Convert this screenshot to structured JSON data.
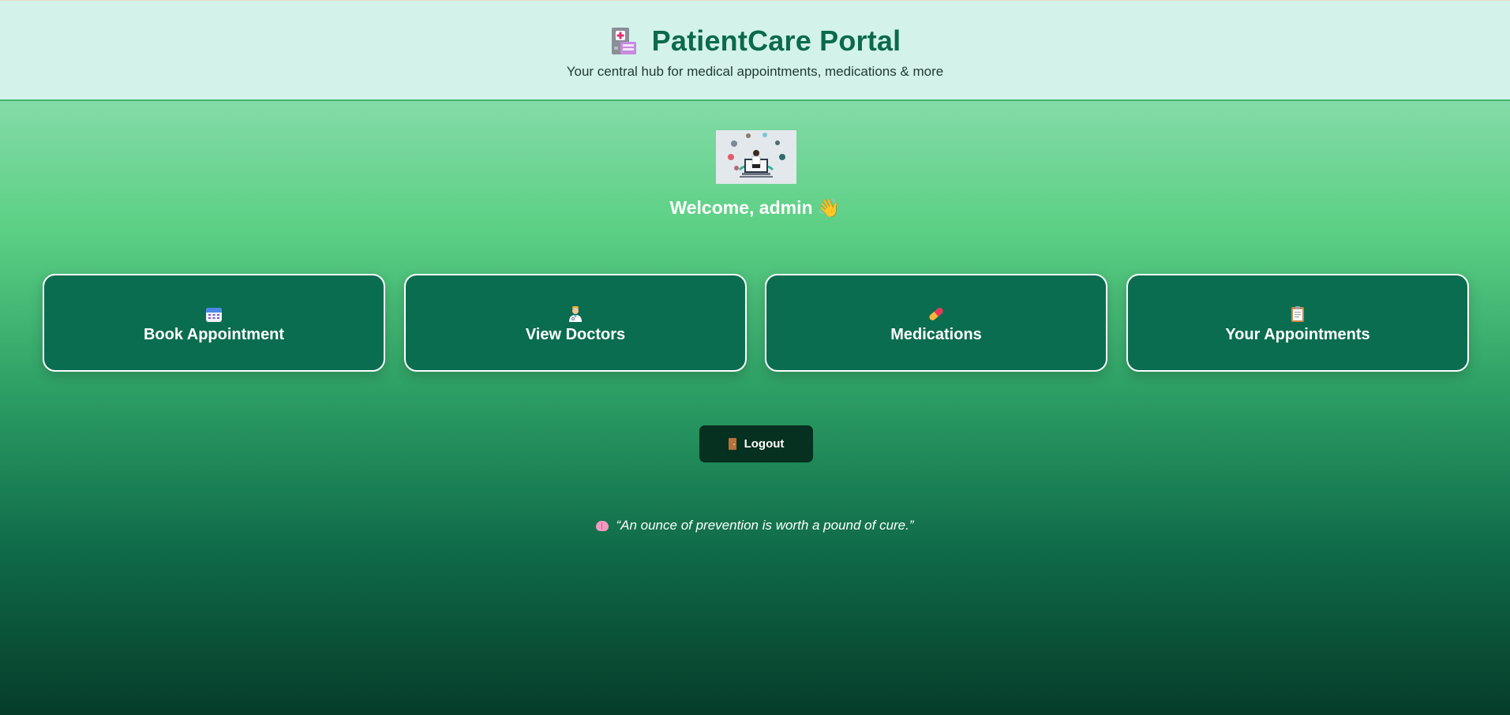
{
  "header": {
    "title": "PatientCare Portal",
    "subtitle": "Your central hub for medical appointments, medications & more",
    "title_icon": "hospital-icon"
  },
  "hero": {
    "image": "telemedicine-illustration"
  },
  "welcome": {
    "text": "Welcome, admin 👋"
  },
  "cards": [
    {
      "label": "Book Appointment",
      "icon": "calendar-icon"
    },
    {
      "label": "View Doctors",
      "icon": "doctor-icon"
    },
    {
      "label": "Medications",
      "icon": "pill-icon"
    },
    {
      "label": "Your Appointments",
      "icon": "clipboard-icon"
    }
  ],
  "logout": {
    "label": "Logout",
    "icon": "door-icon"
  },
  "quote": {
    "text": "“An ounce of prevention is worth a pound of cure.”",
    "icon": "brain-icon"
  },
  "colors": {
    "header_bg": "#d3f2ea",
    "title": "#0b6a4c",
    "card_bg": "#0b6d50",
    "logout_bg": "#06301f"
  }
}
